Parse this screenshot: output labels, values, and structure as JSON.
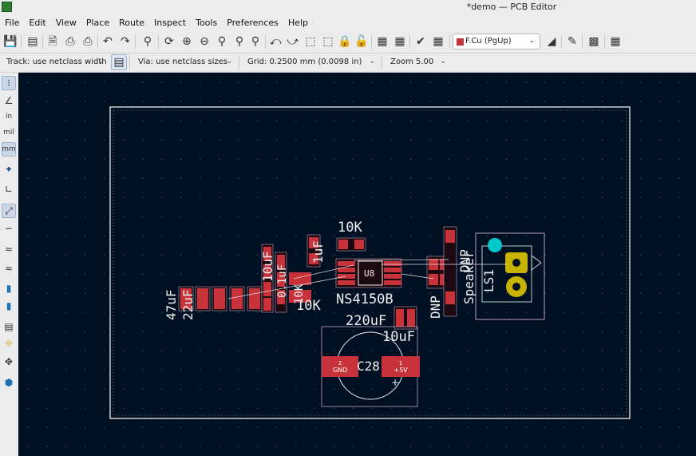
{
  "window": {
    "title": "*demo — PCB Editor"
  },
  "menu": [
    "File",
    "Edit",
    "View",
    "Place",
    "Route",
    "Inspect",
    "Tools",
    "Preferences",
    "Help"
  ],
  "toolbar": {
    "layer_select": "F.Cu (PgUp)",
    "icons": [
      "save-icon",
      "board-setup-icon",
      "page-settings-icon",
      "print-icon",
      "plot-icon",
      "undo-icon",
      "redo-icon",
      "find-icon",
      "refresh-icon",
      "zoom-in-icon",
      "zoom-out-icon",
      "zoom-fit-icon",
      "zoom-objects-icon",
      "zoom-area-icon",
      "rotate-ccw-icon",
      "rotate-cw-icon",
      "group-icon",
      "ungroup-icon",
      "lock-icon",
      "unlock-icon",
      "netlist-icon",
      "library-icon",
      "drc-icon",
      "board-stats-icon",
      "layer-pair-icon",
      "push-router-icon",
      "scripting-console-icon",
      "footprint-editor-icon"
    ]
  },
  "aux_toolbar": {
    "track": "Track: use netclass width",
    "via": "Via: use netclass sizes",
    "grid": "Grid: 0.2500 mm (0.0098 in)",
    "zoom": "Zoom 5.00"
  },
  "left_toolbar": {
    "icons": [
      "grid-icon",
      "polar-coords-icon",
      "inches-icon",
      "mils-icon",
      "millimeters-icon",
      "cursor-icon",
      "track-icon",
      "ratsnest-icon",
      "curved-ratsnest-icon",
      "track-outline-icon",
      "zone-fill-icon",
      "via-icon",
      "layer-icon",
      "cross-probe-icon",
      "high-contrast-icon",
      "selection-icon",
      "appearance-icon"
    ],
    "labels": {
      "inches": "in",
      "mils": "mil",
      "millimeters": "mm"
    }
  },
  "board": {
    "designators": [
      "10K",
      "1uF",
      "U8",
      "DNP",
      "DNP",
      "Speaker",
      "LS1",
      "NS4150B",
      "10K",
      "220uF",
      "10uF",
      "C28",
      "47uF",
      "22uF",
      "10uF",
      "0.1uF",
      "10K"
    ],
    "pads": {
      "gnd_number": "2",
      "gnd_net": "GND",
      "pwr_number": "1",
      "pwr_net": "+5V",
      "plus": "+"
    }
  },
  "colors": {
    "canvas_bg": "#001023",
    "copper": "#c8323a",
    "silkscreen": "#f0f0f0",
    "courtyard": "#c0a0c0",
    "board_edge": "#d0d0d0",
    "via": "#00c8c8",
    "through_hole": "#c8b400"
  }
}
